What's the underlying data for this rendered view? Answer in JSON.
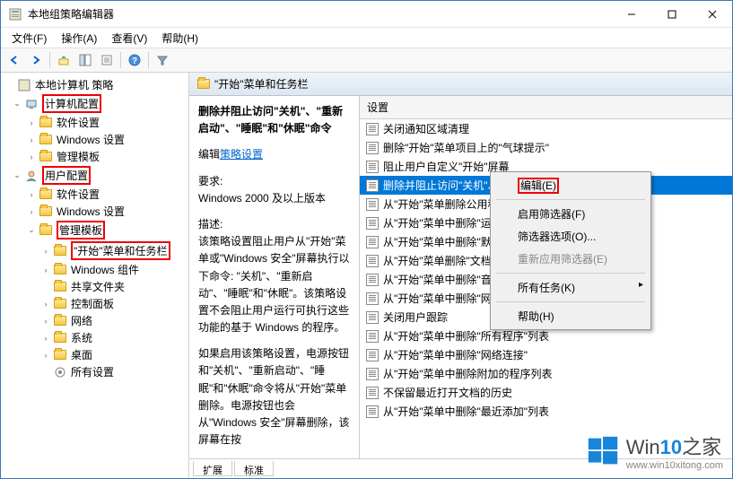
{
  "window": {
    "title": "本地组策略编辑器"
  },
  "menubar": {
    "file": "文件(F)",
    "action": "操作(A)",
    "view": "查看(V)",
    "help": "帮助(H)"
  },
  "tree": {
    "root": "本地计算机 策略",
    "computer_config": "计算机配置",
    "software_settings": "软件设置",
    "windows_settings": "Windows 设置",
    "admin_templates": "管理模板",
    "user_config": "用户配置",
    "start_taskbar": "\"开始\"菜单和任务栏",
    "windows_components": "Windows 组件",
    "shared_folders": "共享文件夹",
    "control_panel": "控制面板",
    "network": "网络",
    "system": "系统",
    "desktop": "桌面",
    "all_settings": "所有设置"
  },
  "detail": {
    "header": "\"开始\"菜单和任务栏",
    "title": "删除并阻止访问\"关机\"、\"重新启动\"、\"睡眠\"和\"休眠\"命令",
    "edit_label": "编辑",
    "policy_link": "策略设置",
    "req_label": "要求:",
    "req_value": "Windows 2000 及以上版本",
    "desc_label": "描述:",
    "desc_body": "该策略设置阻止用户从\"开始\"菜单或\"Windows 安全\"屏幕执行以下命令: \"关机\"、\"重新启动\"、\"睡眠\"和\"休眠\"。该策略设置不会阻止用户运行可执行这些功能的基于 Windows 的程序。",
    "desc_body2": "如果启用该策略设置，电源按钮和\"关机\"、\"重新启动\"、\"睡眠\"和\"休眠\"命令将从\"开始\"菜单删除。电源按钮也会从\"Windows 安全\"屏幕删除，该屏幕在按",
    "list_header": "设置",
    "items": [
      "关闭通知区域清理",
      "删除\"开始\"菜单项目上的\"气球提示\"",
      "阻止用户自定义\"开始\"屏幕",
      "删除并阻止访问\"关机\"、\"重新启动\"、\"睡眠\"和\"休眠\"命令",
      "从\"开始\"菜单删除公用程序",
      "从\"开始\"菜单中删除\"运行\"菜单",
      "从\"开始\"菜单中删除\"默认程序\"链接",
      "从\"开始\"菜单删除\"文档\"图标",
      "从\"开始\"菜单中删除\"音乐\"图标",
      "从\"开始\"菜单中删除\"网络\"图标",
      "关闭用户跟踪",
      "从\"开始\"菜单中删除\"所有程序\"列表",
      "从\"开始\"菜单中删除\"网络连接\"",
      "从\"开始\"菜单中删除附加的程序列表",
      "不保留最近打开文档的历史",
      "从\"开始\"菜单中删除\"最近添加\"列表"
    ]
  },
  "context_menu": {
    "edit": "编辑(E)",
    "filter_on": "启用筛选器(F)",
    "filter_opts": "筛选器选项(O)...",
    "reapply": "重新应用筛选器(E)",
    "all_tasks": "所有任务(K)",
    "help": "帮助(H)"
  },
  "tabs": {
    "extended": "扩展",
    "standard": "标准"
  },
  "watermark": {
    "brand_a": "Win",
    "brand_b": "10",
    "brand_c": "之家",
    "url": "www.win10xitong.com"
  }
}
